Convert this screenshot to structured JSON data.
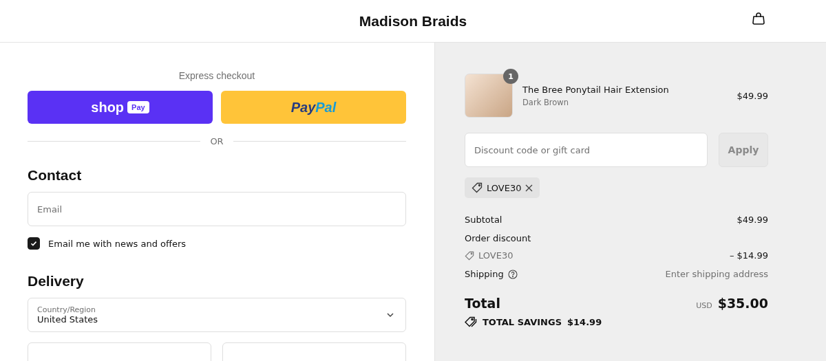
{
  "header": {
    "store_name": "Madison Braids"
  },
  "express_checkout": {
    "title": "Express checkout",
    "shop_pay": {
      "wordmark": "shop",
      "badge": "Pay"
    },
    "paypal": {
      "part_1": "Pay",
      "part_2": "Pal"
    },
    "divider": "OR"
  },
  "contact": {
    "heading": "Contact",
    "email_field": {
      "placeholder": "Email"
    },
    "newsletter": {
      "label": "Email me with news and offers",
      "checked": true
    }
  },
  "delivery": {
    "heading": "Delivery",
    "country": {
      "label": "Country/Region",
      "value": "United States"
    }
  },
  "order_summary": {
    "items": [
      {
        "name": "The Bree Ponytail Hair Extension",
        "variant": "Dark Brown",
        "price": "$49.99",
        "quantity": "1"
      }
    ],
    "discount_field": {
      "placeholder": "Discount code or gift card"
    },
    "apply_button": {
      "label": "Apply",
      "disabled": true
    },
    "applied_codes": [
      {
        "code": "LOVE30"
      }
    ],
    "subtotal": {
      "label": "Subtotal",
      "value": "$49.99"
    },
    "order_discount": {
      "label": "Order discount",
      "code": "LOVE30",
      "value": "– $14.99"
    },
    "shipping": {
      "label": "Shipping",
      "value": "Enter shipping address"
    },
    "total": {
      "label": "Total",
      "currency": "USD",
      "value": "$35.00"
    },
    "savings": {
      "label": "TOTAL SAVINGS",
      "value": "$14.99"
    }
  }
}
